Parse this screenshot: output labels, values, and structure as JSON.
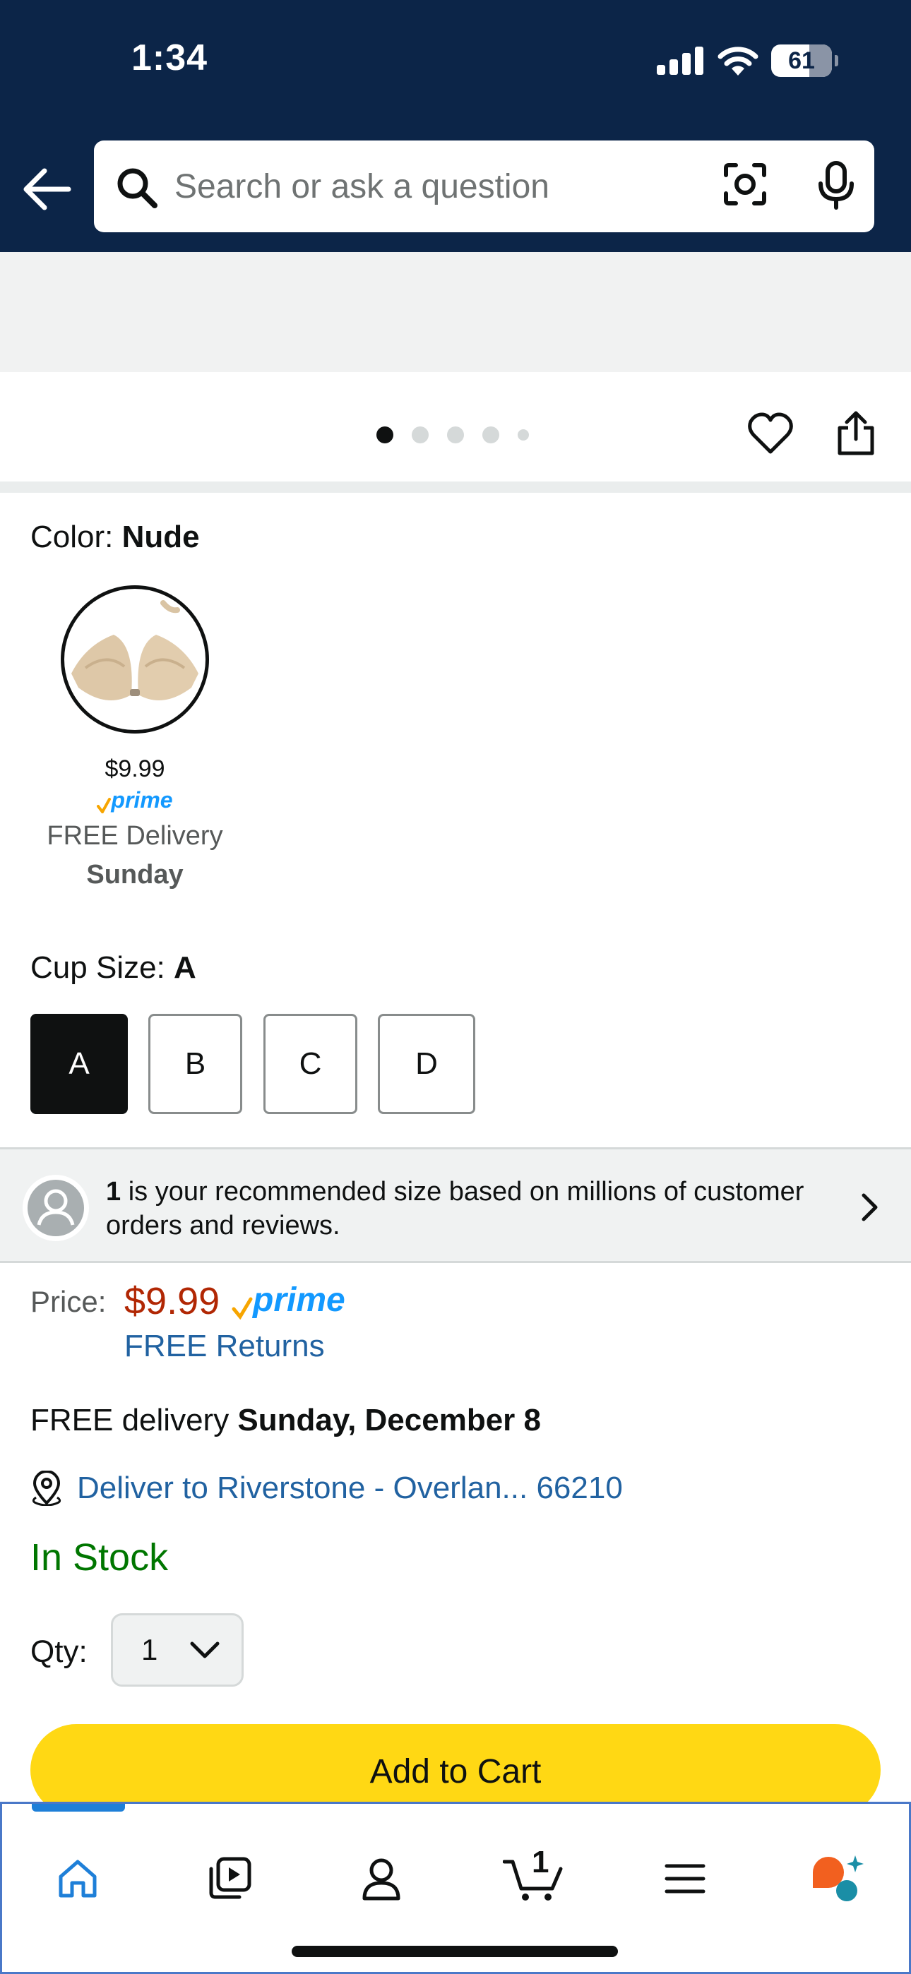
{
  "status_bar": {
    "time": "1:34",
    "battery": "61"
  },
  "search": {
    "placeholder": "Search or ask a question"
  },
  "image_carousel": {
    "dot_count": 5,
    "active_index": 0
  },
  "color": {
    "label": "Color: ",
    "value": "Nude"
  },
  "swatch": {
    "price": "$9.99",
    "prime": "prime",
    "delivery": "FREE Delivery",
    "day": "Sunday"
  },
  "cup_size": {
    "label": "Cup Size: ",
    "value": "A",
    "options": [
      "A",
      "B",
      "C",
      "D"
    ],
    "selected": "A"
  },
  "recommendation": {
    "size": "1",
    "text": " is your recommended size based on millions of customer orders and reviews."
  },
  "pricing": {
    "label": "Price:",
    "value": "$9.99",
    "prime": "prime",
    "returns": "FREE Returns"
  },
  "delivery": {
    "prefix": "FREE delivery ",
    "date": "Sunday, December 8",
    "deliver_to": "Deliver to Riverstone - Overlan... 66210"
  },
  "stock": "In Stock",
  "quantity": {
    "label": "Qty:",
    "value": "1"
  },
  "add_to_cart": "Add to Cart",
  "tabbar": {
    "cart_count": "1",
    "tabs": [
      "home-icon",
      "video-icon",
      "account-icon",
      "cart-icon",
      "menu-icon",
      "assistant-icon"
    ]
  },
  "colors": {
    "header": "#0c2548",
    "price": "#b12704",
    "link": "#2162a1",
    "in_stock": "#007600",
    "add_to_cart": "#ffd814",
    "prime": "#1399ff"
  }
}
